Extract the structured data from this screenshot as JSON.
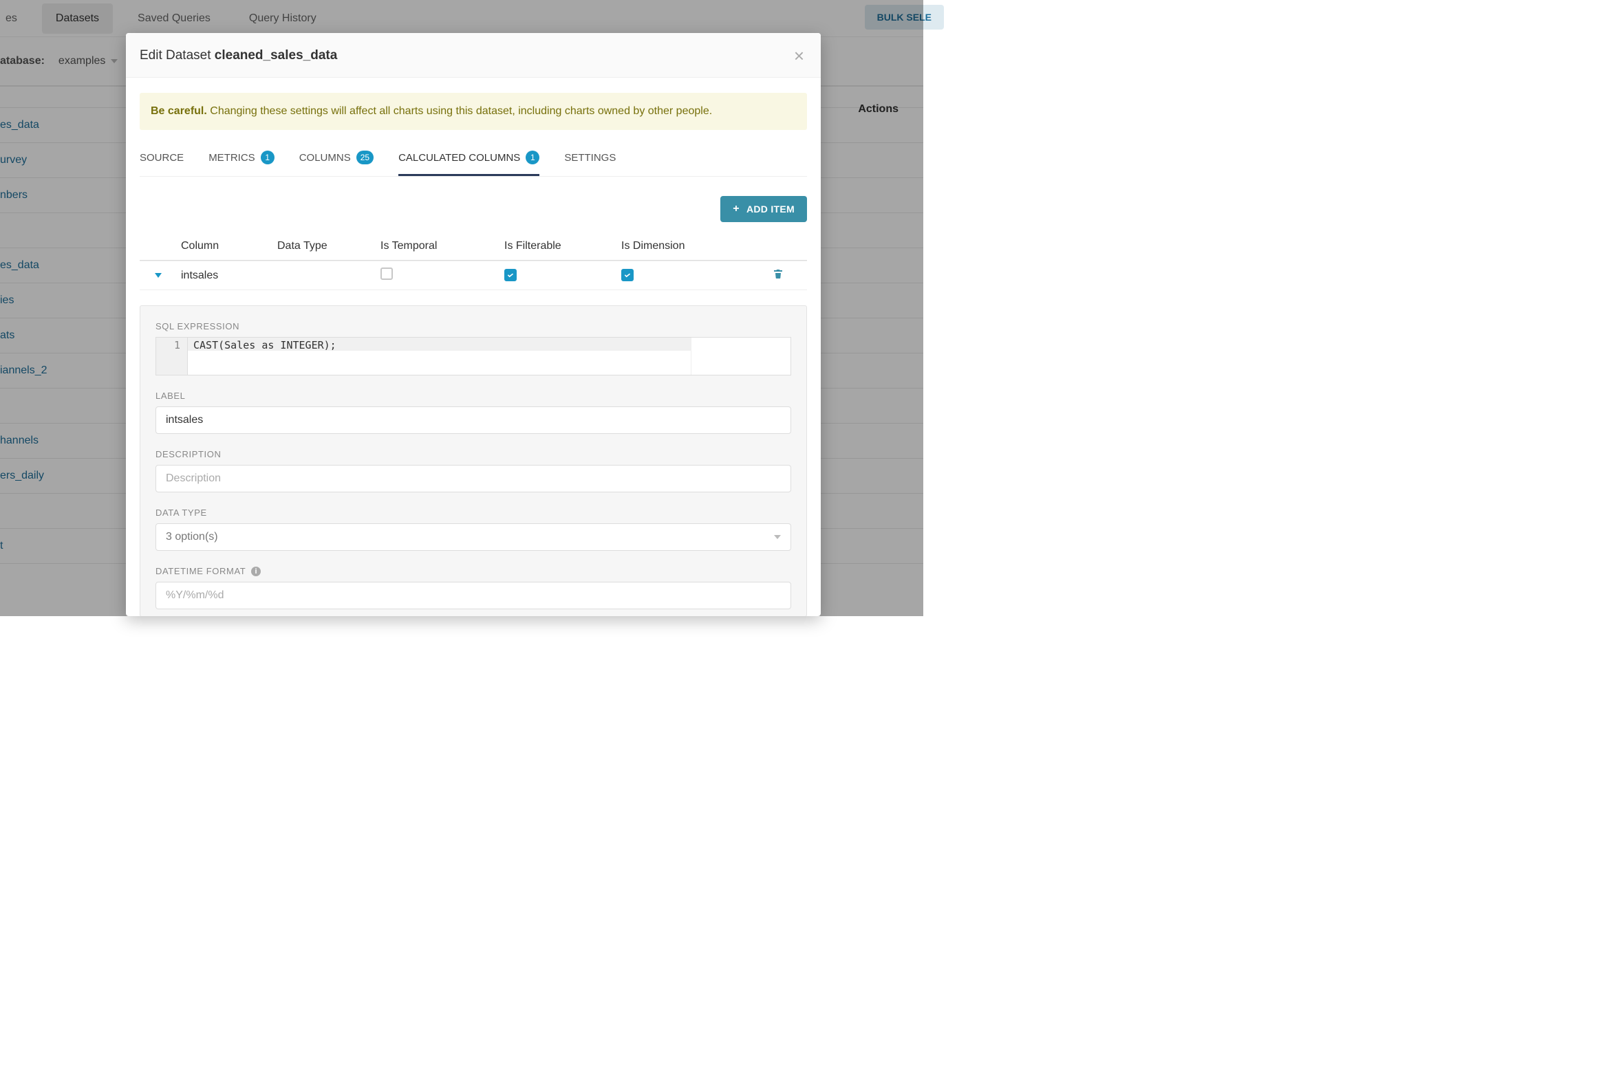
{
  "topnav": {
    "tabs": [
      "es",
      "Datasets",
      "Saved Queries",
      "Query History"
    ],
    "active_index": 1,
    "bulk_button": "BULK SELE"
  },
  "filterbar": {
    "label": "atabase:",
    "selected": "examples"
  },
  "listing": {
    "actions_header": "Actions",
    "rows": [
      "es_data",
      "urvey",
      "nbers",
      "",
      "es_data",
      "ies",
      "ats",
      "iannels_2",
      "",
      "hannels",
      "ers_daily",
      "",
      "t",
      ""
    ]
  },
  "modal": {
    "title_prefix": "Edit Dataset ",
    "title_name": "cleaned_sales_data",
    "warning_bold": "Be careful.",
    "warning_text": " Changing these settings will affect all charts using this dataset, including charts owned by other people.",
    "tabs": [
      {
        "label": "SOURCE"
      },
      {
        "label": "METRICS",
        "badge": "1"
      },
      {
        "label": "COLUMNS",
        "badge": "25"
      },
      {
        "label": "CALCULATED COLUMNS",
        "badge": "1"
      },
      {
        "label": "SETTINGS"
      }
    ],
    "active_tab_index": 3,
    "add_item_label": "ADD ITEM",
    "grid": {
      "headers": [
        "",
        "Column",
        "Data Type",
        "Is Temporal",
        "Is Filterable",
        "Is Dimension",
        "",
        ""
      ],
      "row": {
        "column_name": "intsales",
        "is_temporal": false,
        "is_filterable": true,
        "is_dimension": true
      }
    },
    "detail": {
      "sql_expression_label": "SQL EXPRESSION",
      "sql_line_no": "1",
      "sql_code": "CAST(Sales as INTEGER);",
      "label_label": "LABEL",
      "label_value": "intsales",
      "description_label": "DESCRIPTION",
      "description_placeholder": "Description",
      "datatype_label": "DATA TYPE",
      "datatype_value": "3 option(s)",
      "datetime_label": "DATETIME FORMAT",
      "datetime_placeholder": "%Y/%m/%d"
    }
  }
}
